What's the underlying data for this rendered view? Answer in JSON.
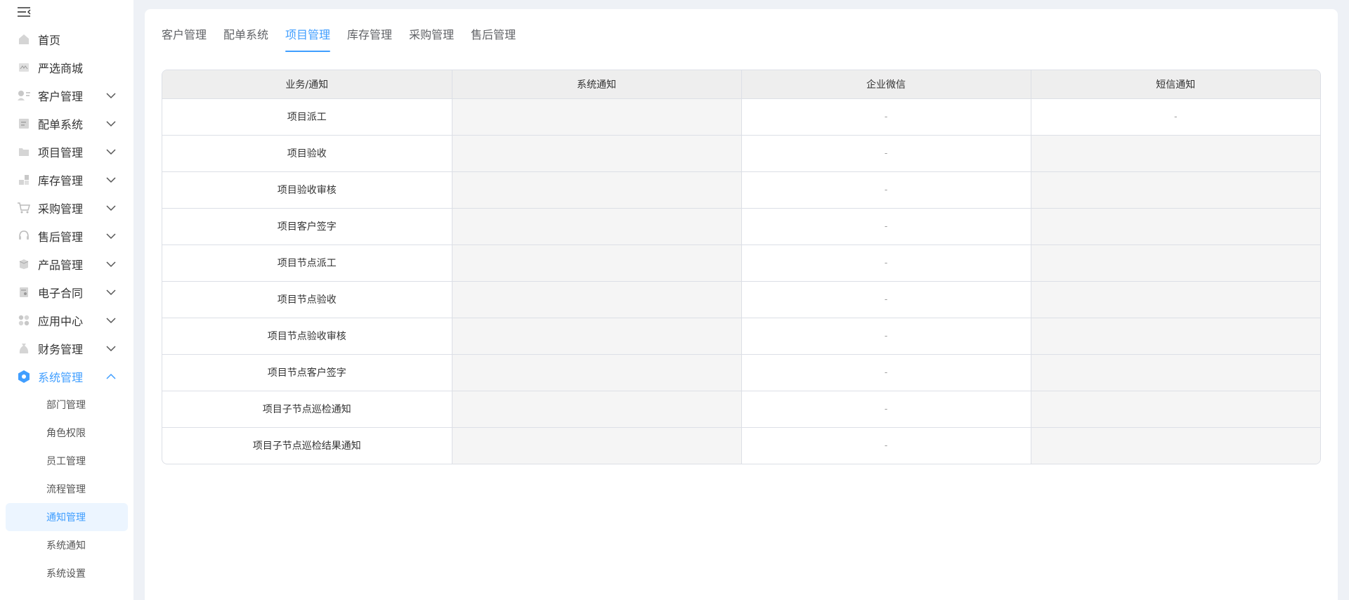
{
  "sidebar": {
    "menu": [
      {
        "label": "首页",
        "icon": "home-icon",
        "has_arrow": false
      },
      {
        "label": "严选商城",
        "icon": "store-icon",
        "has_arrow": false
      },
      {
        "label": "客户管理",
        "icon": "customer-icon",
        "has_arrow": true
      },
      {
        "label": "配单系统",
        "icon": "order-icon",
        "has_arrow": true
      },
      {
        "label": "项目管理",
        "icon": "folder-icon",
        "has_arrow": true
      },
      {
        "label": "库存管理",
        "icon": "inventory-icon",
        "has_arrow": true
      },
      {
        "label": "采购管理",
        "icon": "cart-icon",
        "has_arrow": true
      },
      {
        "label": "售后管理",
        "icon": "headset-icon",
        "has_arrow": true
      },
      {
        "label": "产品管理",
        "icon": "box-icon",
        "has_arrow": true
      },
      {
        "label": "电子合同",
        "icon": "contract-icon",
        "has_arrow": true
      },
      {
        "label": "应用中心",
        "icon": "apps-icon",
        "has_arrow": true
      },
      {
        "label": "财务管理",
        "icon": "finance-icon",
        "has_arrow": true
      },
      {
        "label": "系统管理",
        "icon": "settings-icon",
        "has_arrow": true,
        "expanded": true
      }
    ],
    "submenu": [
      {
        "label": "部门管理"
      },
      {
        "label": "角色权限"
      },
      {
        "label": "员工管理"
      },
      {
        "label": "流程管理"
      },
      {
        "label": "通知管理",
        "selected": true
      },
      {
        "label": "系统通知"
      },
      {
        "label": "系统设置"
      }
    ]
  },
  "tabs": [
    {
      "label": "客户管理"
    },
    {
      "label": "配单系统"
    },
    {
      "label": "项目管理",
      "active": true
    },
    {
      "label": "库存管理"
    },
    {
      "label": "采购管理"
    },
    {
      "label": "售后管理"
    }
  ],
  "table": {
    "headers": [
      "业务/通知",
      "系统通知",
      "企业微信",
      "短信通知"
    ],
    "rows": [
      {
        "name": "项目派工",
        "system": "",
        "wecom": "-",
        "sms": "-"
      },
      {
        "name": "项目验收",
        "system": "",
        "wecom": "-",
        "sms": ""
      },
      {
        "name": "项目验收审核",
        "system": "",
        "wecom": "-",
        "sms": ""
      },
      {
        "name": "项目客户签字",
        "system": "",
        "wecom": "-",
        "sms": ""
      },
      {
        "name": "项目节点派工",
        "system": "",
        "wecom": "-",
        "sms": ""
      },
      {
        "name": "项目节点验收",
        "system": "",
        "wecom": "-",
        "sms": ""
      },
      {
        "name": "项目节点验收审核",
        "system": "",
        "wecom": "-",
        "sms": ""
      },
      {
        "name": "项目节点客户签字",
        "system": "",
        "wecom": "-",
        "sms": ""
      },
      {
        "name": "项目子节点巡检通知",
        "system": "",
        "wecom": "-",
        "sms": ""
      },
      {
        "name": "项目子节点巡检结果通知",
        "system": "",
        "wecom": "-",
        "sms": ""
      }
    ]
  },
  "colors": {
    "accent": "#409eff",
    "page_bg": "#eef1f6",
    "header_bg": "#eeeeee",
    "disabled_cell_bg": "#f5f5f5"
  }
}
